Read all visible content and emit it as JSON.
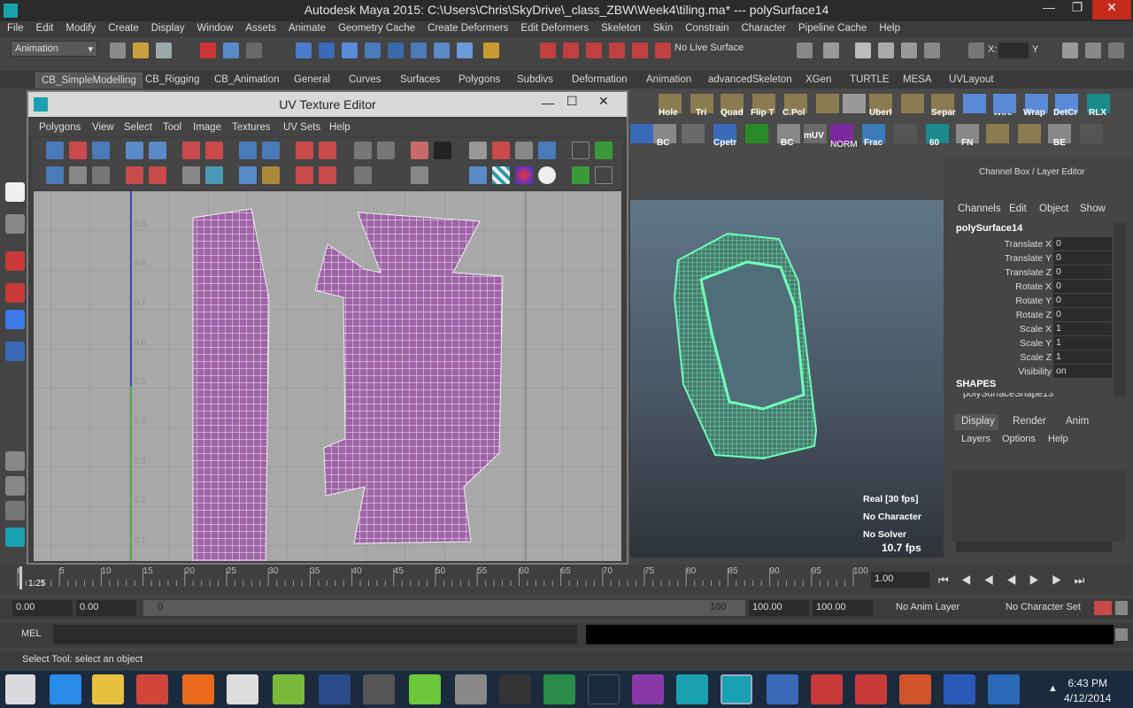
{
  "window": {
    "title": "Autodesk Maya 2015: C:\\Users\\Chris\\SkyDrive\\_class_ZBW\\Week4\\tiling.ma*   ---   polySurface14"
  },
  "menubar": [
    "File",
    "Edit",
    "Modify",
    "Create",
    "Display",
    "Window",
    "Assets",
    "Animate",
    "Geometry Cache",
    "Create Deformers",
    "Edit Deformers",
    "Skeleton",
    "Skin",
    "Constrain",
    "Character",
    "Pipeline Cache",
    "Help"
  ],
  "status": {
    "mode": "Animation",
    "live_surface": "No Live Surface",
    "x_label": "X:",
    "y_label": "Y"
  },
  "shelf_tabs": [
    "CB_SimpleModelling",
    "CB_Rigging",
    "CB_Animation",
    "General",
    "Curves",
    "Surfaces",
    "Polygons",
    "Subdivs",
    "Deformation",
    "Animation",
    "advancedSkeleton",
    "XGen",
    "TURTLE",
    "MESA",
    "UVLayout"
  ],
  "shelf_labels_row1": [
    "Hole",
    "Tri",
    "Quad",
    "Flip T",
    "C.Pol",
    "",
    "UberI",
    "",
    "Separ",
    "Wire",
    "Wrap",
    "DetCr",
    "RLX"
  ],
  "shelf_labels_row2": [
    "BC",
    "",
    "Cpetr",
    "",
    "BC",
    "mUV",
    "NORM",
    "Frac",
    "",
    "60",
    "FN",
    "",
    "",
    "BE",
    ""
  ],
  "uv_editor": {
    "title": "UV Texture Editor",
    "menu": [
      "Polygons",
      "View",
      "Select",
      "Tool",
      "Image",
      "Textures",
      "UV Sets",
      "Help"
    ],
    "v_ticks": [
      "0.9",
      "0.8",
      "0.7",
      "0.6",
      "0.5",
      "0.4",
      "0.3",
      "0.2",
      "0.1"
    ]
  },
  "viewport": {
    "hud": [
      "Real [30 fps]",
      "No Character",
      "No Solver"
    ],
    "fps": "10.7 fps"
  },
  "channel_box": {
    "title": "Channel Box / Layer Editor",
    "menu": [
      "Channels",
      "Edit",
      "Object",
      "Show"
    ],
    "object": "polySurface14",
    "channels": [
      {
        "name": "Translate X",
        "value": "0"
      },
      {
        "name": "Translate Y",
        "value": "0"
      },
      {
        "name": "Translate Z",
        "value": "0"
      },
      {
        "name": "Rotate X",
        "value": "0"
      },
      {
        "name": "Rotate Y",
        "value": "0"
      },
      {
        "name": "Rotate Z",
        "value": "0"
      },
      {
        "name": "Scale X",
        "value": "1"
      },
      {
        "name": "Scale Y",
        "value": "1"
      },
      {
        "name": "Scale Z",
        "value": "1"
      },
      {
        "name": "Visibility",
        "value": "on"
      }
    ],
    "shapes_label": "SHAPES",
    "shape_name": "polySurfaceShape13",
    "layer_tabs": [
      "Display",
      "Render",
      "Anim"
    ],
    "layer_menu": [
      "Layers",
      "Options",
      "Help"
    ]
  },
  "timeline": {
    "ticks": [
      "0",
      "5",
      "10",
      "15",
      "20",
      "25",
      "30",
      "35",
      "40",
      "45",
      "50",
      "55",
      "60",
      "65",
      "70",
      "75",
      "80",
      "85",
      "90",
      "95",
      "100"
    ],
    "current": "1.25",
    "current_field": "1.00"
  },
  "range": {
    "start": "0.00",
    "start2": "0.00",
    "slider_start": "0",
    "slider_end": "100",
    "end1": "100.00",
    "end2": "100.00",
    "anim_layer": "No Anim Layer",
    "char_set": "No Character Set"
  },
  "mel": {
    "label": "MEL"
  },
  "help_line": "Select Tool: select an object",
  "taskbar": {
    "time": "6:43 PM",
    "date": "4/12/2014",
    "apps": [
      "windows",
      "ie",
      "explorer",
      "chrome",
      "firefox",
      "zbrush",
      "mudbox",
      "photoshop",
      "unity",
      "spotify",
      "cloud",
      "substance",
      "excel",
      "hp",
      "xnormal",
      "maya2014",
      "maya2015",
      "rb",
      "substance2",
      "substance3",
      "powerpoint",
      "word",
      "unreal"
    ]
  }
}
